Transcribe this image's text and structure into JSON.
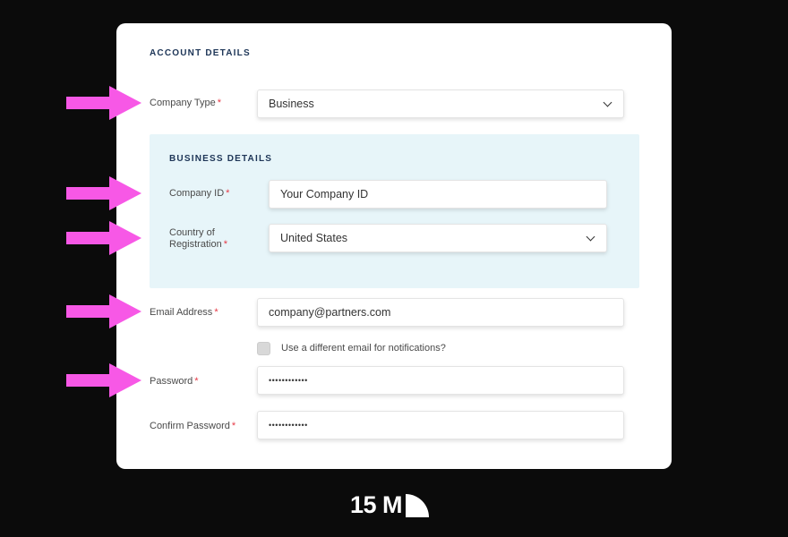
{
  "account": {
    "section_title": "ACCOUNT DETAILS",
    "company_type": {
      "label": "Company Type",
      "required_mark": "*",
      "value": "Business"
    },
    "email": {
      "label": "Email Address",
      "required_mark": "*",
      "value": "company@partners.com"
    },
    "notify_checkbox": {
      "label": "Use a different email for notifications?",
      "checked": false
    },
    "password": {
      "label": "Password",
      "required_mark": "*",
      "value": "••••••••••••"
    },
    "confirm_password": {
      "label": "Confirm Password",
      "required_mark": "*",
      "value": "••••••••••••"
    }
  },
  "business": {
    "section_title": "BUSINESS DETAILS",
    "company_id": {
      "label": "Company ID",
      "required_mark": "*",
      "placeholder": "Your Company ID"
    },
    "country": {
      "label_line1": "Country of",
      "label_line2": "Registration",
      "required_mark": "*",
      "value": "United States"
    }
  },
  "logo": {
    "text": "15 M"
  },
  "colors": {
    "arrow": "#f758e6",
    "required": "#e63946",
    "business_bg": "#e7f5f9",
    "background": "#0b0b0b"
  },
  "icons": [
    "arrow-right-icon",
    "chevron-down-icon",
    "logo-mark-icon"
  ]
}
